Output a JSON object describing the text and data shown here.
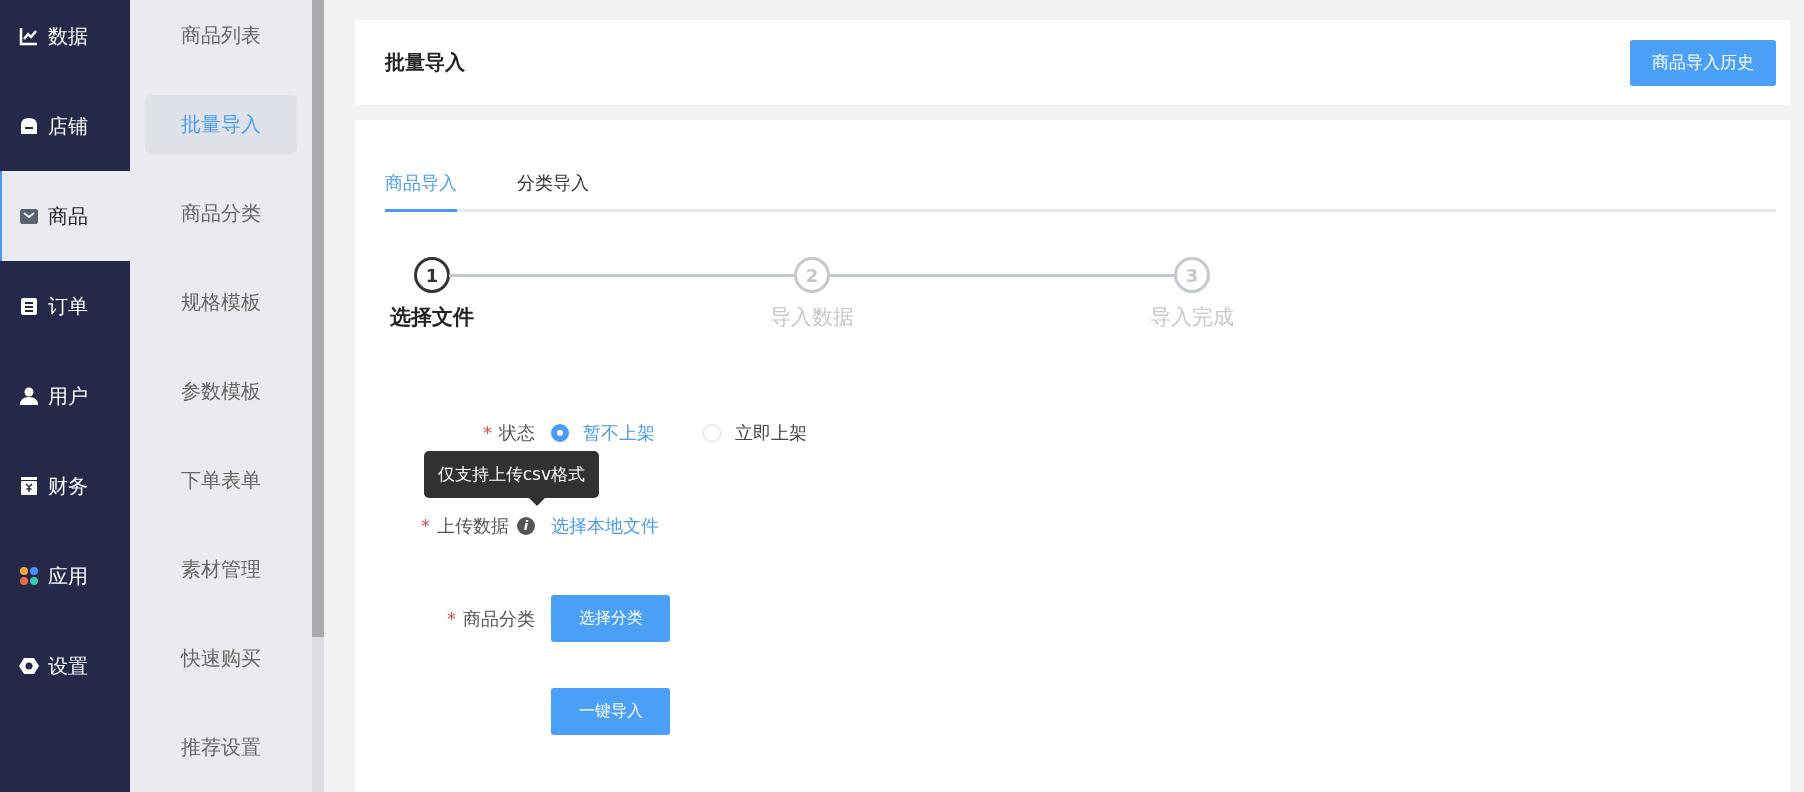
{
  "nav": [
    {
      "label": "数据",
      "selected": false
    },
    {
      "label": "店铺",
      "selected": false
    },
    {
      "label": "商品",
      "selected": true
    },
    {
      "label": "订单",
      "selected": false
    },
    {
      "label": "用户",
      "selected": false
    },
    {
      "label": "财务",
      "selected": false
    },
    {
      "label": "应用",
      "selected": false
    },
    {
      "label": "设置",
      "selected": false
    }
  ],
  "subnav": [
    {
      "label": "商品列表",
      "selected": false
    },
    {
      "label": "批量导入",
      "selected": true
    },
    {
      "label": "商品分类",
      "selected": false
    },
    {
      "label": "规格模板",
      "selected": false
    },
    {
      "label": "参数模板",
      "selected": false
    },
    {
      "label": "下单表单",
      "selected": false
    },
    {
      "label": "素材管理",
      "selected": false
    },
    {
      "label": "快速购买",
      "selected": false
    },
    {
      "label": "推荐设置",
      "selected": false
    }
  ],
  "header": {
    "title": "批量导入",
    "button": "商品导入历史"
  },
  "tabs": [
    {
      "label": "商品导入",
      "selected": true
    },
    {
      "label": "分类导入",
      "selected": false
    }
  ],
  "steps": [
    {
      "number": "1",
      "label": "选择文件",
      "selected": true
    },
    {
      "number": "2",
      "label": "导入数据",
      "selected": false
    },
    {
      "number": "3",
      "label": "导入完成",
      "selected": false
    }
  ],
  "form": {
    "status": {
      "label": "状态",
      "required_mark": "*",
      "options": [
        {
          "label": "暂不上架",
          "selected": true
        },
        {
          "label": "立即上架",
          "selected": false
        }
      ]
    },
    "upload": {
      "label": "上传数据",
      "required_mark": "*",
      "info_icon": "i",
      "tooltip": "仅支持上传csv格式",
      "link": "选择本地文件"
    },
    "category": {
      "label": "商品分类",
      "required_mark": "*",
      "button": "选择分类"
    },
    "submit": "一键导入"
  }
}
